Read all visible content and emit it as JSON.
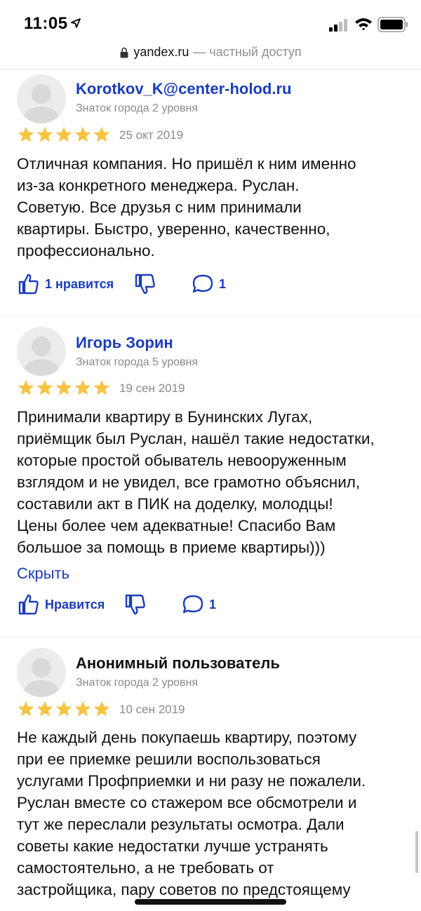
{
  "status_bar": {
    "time": "11:05"
  },
  "url_bar": {
    "domain": "yandex.ru",
    "suffix": "— частный доступ"
  },
  "reviews": [
    {
      "author": "Korotkov_K@center-holod.ru",
      "level": "Знаток города 2 уровня",
      "rating": 5,
      "date": "25 окт 2019",
      "text": "Отличная компания. Но пришёл к ним именно\nиз-за конкретного менеджера. Руслан.\nСоветую. Все друзья с ним принимали\nквартиры. Быстро, уверенно, качественно,\nпрофессионально.",
      "like_label": "1 нравится",
      "comments": "1"
    },
    {
      "author": "Игорь Зорин",
      "level": "Знаток города 5 уровня",
      "rating": 5,
      "date": "19 сен 2019",
      "text": "Принимали квартиру в Бунинских Лугах,\nприёмщик был Руслан, нашёл такие недостатки,\nкоторые простой обыватель невооруженным\nвзглядом и не увидел, все грамотно объяснил,\nсоставили акт в ПИК на доделку, молодцы!\nЦены более чем адекватные! Спасибо Вам\nбольшое за помощь в приеме квартиры)))",
      "hide_label": "Скрыть",
      "like_label": "Нравится",
      "comments": "1"
    },
    {
      "author": "Анонимный пользователь",
      "level": "Знаток города 2 уровня",
      "rating": 5,
      "date": "10 сен 2019",
      "text": "Не каждый день покупаешь квартиру, поэтому\nпри ее приемке решили воспользоваться\nуслугами Профприемки и ни разу не пожалели.\nРуслан вместе со стажером все обсмотрели и\nтут же переслали результаты осмотра. Дали\nсоветы какие недостатки лучше устранять\nсамостоятельно, а не требовать от\nзастройщика, пару советов по предстоящему"
    }
  ],
  "colors": {
    "link": "#1a3db8",
    "star": "#f6c343",
    "muted": "#8a8a8a"
  }
}
